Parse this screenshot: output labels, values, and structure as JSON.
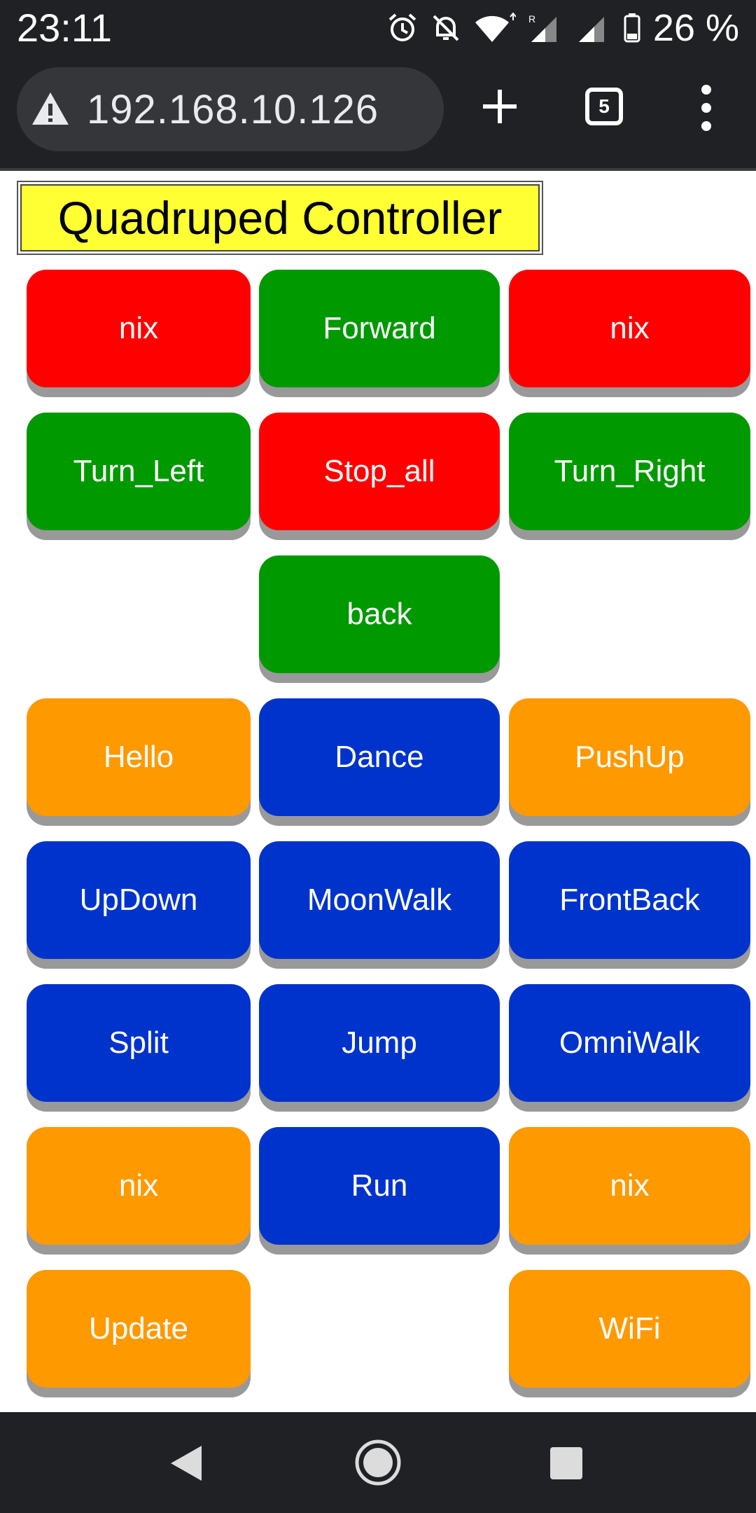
{
  "status_bar": {
    "time": "23:11",
    "battery": "26 %",
    "icons": [
      "alarm-icon",
      "notifications-off-icon",
      "wifi-icon",
      "signal-roaming-icon",
      "signal-icon",
      "battery-icon"
    ]
  },
  "browser": {
    "url": "192.168.10.126",
    "tab_count": "5",
    "icons": [
      "not-secure-warning-icon",
      "new-tab-icon",
      "tab-switcher-icon",
      "overflow-menu-icon"
    ]
  },
  "page": {
    "title": "Quadruped Controller",
    "colors": {
      "red": "#ff0000",
      "green": "#009900",
      "orange": "#ff9900",
      "blue": "#0033cc",
      "title_bg": "#ffff33"
    },
    "buttons": {
      "r1c0": "nix",
      "r1c1": "Forward",
      "r1c2": "nix",
      "r2c0": "Turn_Left",
      "r2c1": "Stop_all",
      "r2c2": "Turn_Right",
      "r3c1": "back",
      "r4c0": "Hello",
      "r4c1": "Dance",
      "r4c2": "PushUp",
      "r5c0": "UpDown",
      "r5c1": "MoonWalk",
      "r5c2": "FrontBack",
      "r6c0": "Split",
      "r6c1": "Jump",
      "r6c2": "OmniWalk",
      "r7c0": "nix",
      "r7c1": "Run",
      "r7c2": "nix",
      "r8c0": "Update",
      "r8c2": "WiFi"
    }
  },
  "nav_bar": {
    "icons": [
      "back-icon",
      "home-icon",
      "recents-icon"
    ]
  }
}
